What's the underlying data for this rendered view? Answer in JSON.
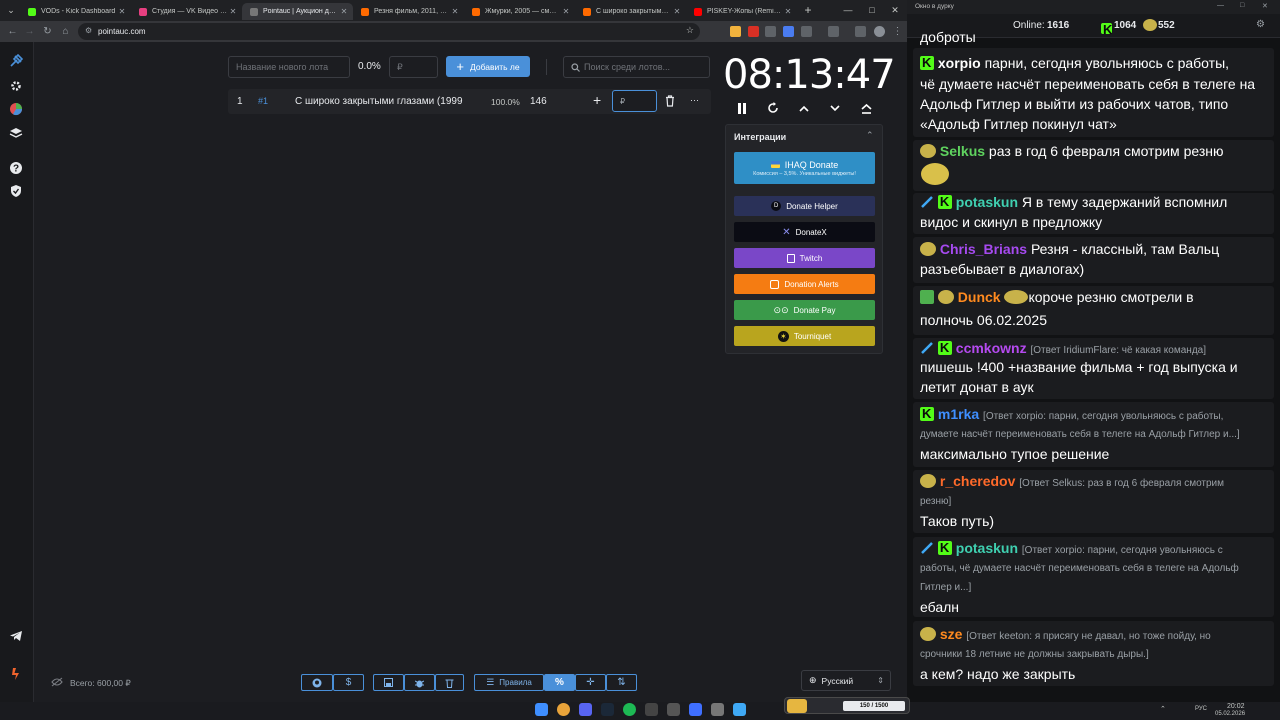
{
  "browser": {
    "tabs": [
      {
        "title": "VODs - Kick Dashboard",
        "color": "#53fc18"
      },
      {
        "title": "Студия — VK Видео Live",
        "color": "#e63f80"
      },
      {
        "title": "Pointauc | Аукцион для стр",
        "color": "#3a3a3a"
      },
      {
        "title": "Резня фильм, 2011, дата вы",
        "color": "#ff6a00"
      },
      {
        "title": "Жмурки, 2005 — смотреть",
        "color": "#ff6a00"
      },
      {
        "title": "С широко закрытыми глаз",
        "color": "#ff6a00"
      },
      {
        "title": "PISKEY-Жопы (Remix BSWI",
        "color": "#ff0000"
      }
    ],
    "new_tab": "+",
    "url": "pointauc.com"
  },
  "toolbar": {
    "lot_name_placeholder": "Название нового лота",
    "percent": "0.0%",
    "amount_placeholder": "₽",
    "add_label": "Добавить ле",
    "search_placeholder": "Поиск среди лотов..."
  },
  "lots": [
    {
      "index": "1",
      "fast_id": "#1",
      "name": "С широко закрытыми глазами (1999",
      "percent": "100.0%",
      "amount": "146",
      "add": "+",
      "input": "₽",
      "more": "···"
    }
  ],
  "timer": {
    "time": "08:13:47"
  },
  "integrations": {
    "title": "Интеграции",
    "ihaq_title": "IHAQ Donate",
    "ihaq_sub": "Комиссия – 3,5%. Уникальные виджеты!",
    "buttons": [
      {
        "label": "Donate Helper",
        "color": "#2a3158"
      },
      {
        "label": "DonateX",
        "color": "#0b0c14"
      },
      {
        "label": "Twitch",
        "color": "#7a47c8"
      },
      {
        "label": "Donation Alerts",
        "color": "#f57c12"
      },
      {
        "label": "Donate Pay",
        "color": "#3a9a4a"
      },
      {
        "label": "Tourniquet",
        "color": "#b9a51e"
      }
    ]
  },
  "footer": {
    "total_label": "Всего: 600,00 ₽",
    "rules_label": "Правила",
    "language": "Русский"
  },
  "chat": {
    "window_title": "Окно в дурку",
    "online_label": "Online:",
    "online_count": "1616",
    "kick_count": "1064",
    "other_count": "552",
    "messages": [
      {
        "lines": [
          "доброты"
        ]
      },
      {
        "nick": "xorpio",
        "nick_color": "#ffffff",
        "text": "парни, сегодня увольняюсь с работы,",
        "lines": [
          "чё думаете насчёт переименовать себя в телеге на",
          "Адольф Гитлер и выйти из рабочих чатов, типо",
          "«Адольф Гитлер покинул чат»"
        ]
      },
      {
        "nick": "Selkus",
        "nick_color": "#5fd35f",
        "text": "раз в год 6 февраля смотрим резню"
      },
      {
        "nick": "potaskun",
        "nick_color": "#3fcfb0",
        "text": "Я в тему задержаний вспомнил",
        "lines": [
          "видос и скинул в предложку"
        ]
      },
      {
        "nick": "Chris_Brians",
        "nick_color": "#a64af0",
        "text": "Резня - классный, там Вальц",
        "lines": [
          "разъебывает в диалогах)"
        ]
      },
      {
        "nick": "Dunck",
        "nick_color": "#ff8a1f",
        "text": "короче резню смотрели в",
        "lines": [
          "полночь 06.02.2025"
        ]
      },
      {
        "nick": "ccmkownz",
        "nick_color": "#b54af0",
        "reply": "[Ответ IridiumFlare: чё какая команда]",
        "lines": [
          "пишешь !400 +название фильма + год выпуска и",
          "летит донат в аук"
        ]
      },
      {
        "nick": "m1rka",
        "nick_color": "#3f8fff",
        "reply": "[Ответ xorpio: парни, сегодня увольняюсь с работы,",
        "lines": [
          "думаете насчёт переименовать себя в телеге на Адольф Гитлер и...]",
          "максимально тупое решение"
        ]
      },
      {
        "nick": "r_cheredov",
        "nick_color": "#ff6a2a",
        "reply": "[Ответ Selkus: раз в год 6 февраля смотрим",
        "lines": [
          "резню]",
          "Таков путь)"
        ]
      },
      {
        "nick": "potaskun",
        "nick_color": "#3fcfb0",
        "reply": "[Ответ xorpio: парни, сегодня увольняюсь с",
        "lines": [
          "работы, чё думаете насчёт переименовать себя в телеге на Адольф",
          "Гитлер и...]",
          "ебалн"
        ]
      },
      {
        "nick": "sze",
        "nick_color": "#ff8a1f",
        "reply": "[Ответ keeton: я присягу не давал, но тоже пойду, но",
        "lines": [
          "срочники 18 летние не должны закрывать дыры.]",
          "а кем? надо же закрыть"
        ]
      }
    ]
  },
  "taskbar": {
    "media": "150 / 1500",
    "lang": "РУС",
    "time": "20:02",
    "date": "05.02.2026"
  }
}
